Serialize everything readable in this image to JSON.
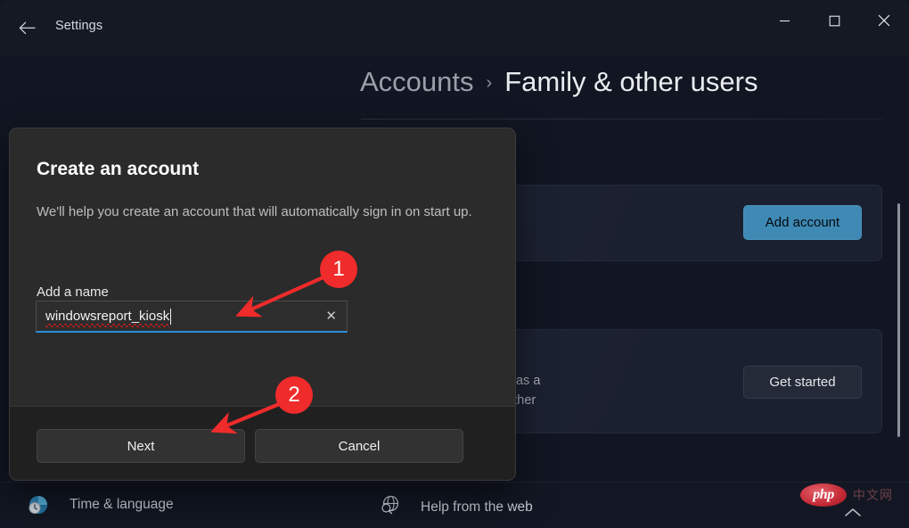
{
  "window": {
    "app_title": "Settings",
    "back_icon": "back-arrow-icon",
    "minimize_label": "–",
    "maximize_label": "□",
    "close_label": "✕"
  },
  "header": {
    "breadcrumb_parent": "Accounts",
    "breadcrumb_separator": "›",
    "breadcrumb_current": "Family & other users"
  },
  "content": {
    "add_account_button": "Add account",
    "kiosk_desc_line1": "evice into a kiosk to use as a",
    "kiosk_desc_line2": ", interactive display, or other",
    "get_started_button": "Get started"
  },
  "dialog": {
    "title": "Create an account",
    "subtitle": "We'll help you create an account that will automatically sign in on start up.",
    "field_label": "Add a name",
    "input_value": "windowsreport_kiosk",
    "input_placeholder": "",
    "clear_icon": "✕",
    "next_button": "Next",
    "cancel_button": "Cancel"
  },
  "bottom_bar": {
    "time_language_label": "Time & language",
    "time_language_icon": "clock-globe-icon",
    "help_label": "Help from the web",
    "help_icon": "globe-search-icon",
    "chevron_icon": "chevron-up-icon"
  },
  "watermark": {
    "php_text": "php",
    "cn_text": "中文网"
  },
  "annotations": [
    {
      "number": "1",
      "target": "name-input"
    },
    {
      "number": "2",
      "target": "next-button"
    }
  ],
  "colors": {
    "accent_blue": "#3e8ab4",
    "focus_blue": "#2a8fe0",
    "annotation_red": "#ef2b2b",
    "spellcheck_red": "#e01919",
    "page_background": "#111622",
    "dialog_background": "#2b2b2b"
  }
}
